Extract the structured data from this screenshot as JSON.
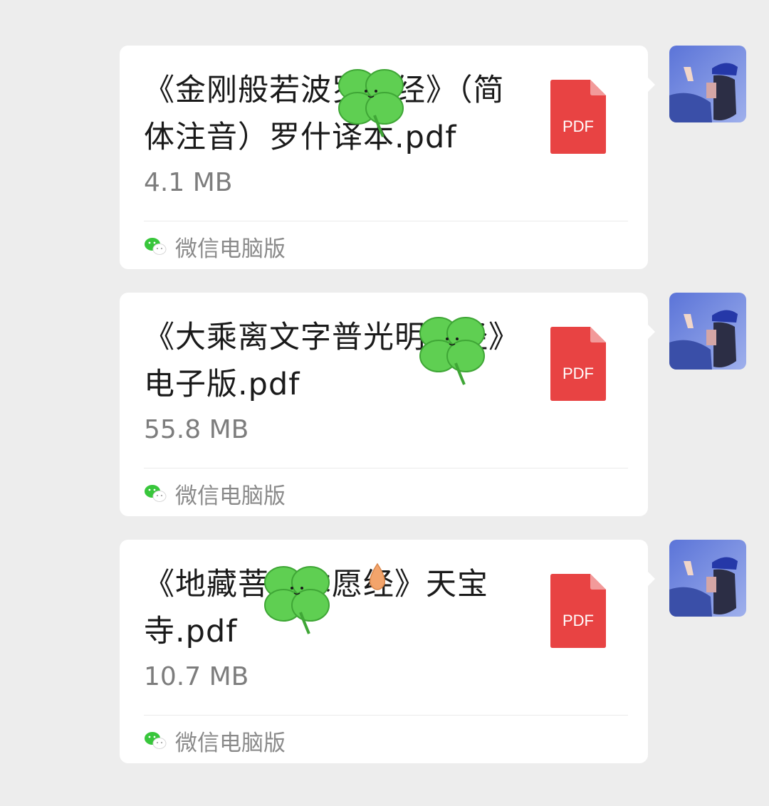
{
  "messages": [
    {
      "file_name": "《金刚般若波罗蜜经》（简体注音）罗什译本.pdf",
      "file_size": "4.1 MB",
      "file_type_badge": "PDF",
      "source_label": "微信电脑版"
    },
    {
      "file_name": "《大乘离文字普光明藏经》电子版.pdf",
      "file_size": "55.8 MB",
      "file_type_badge": "PDF",
      "source_label": "微信电脑版"
    },
    {
      "file_name": "《地藏菩萨本愿经》天宝寺.pdf",
      "file_size": "10.7 MB",
      "file_type_badge": "PDF",
      "source_label": "微信电脑版"
    }
  ],
  "colors": {
    "background": "#ededed",
    "bubble": "#ffffff",
    "pdf_red": "#e84343",
    "wechat_green": "#38c63b",
    "clover_green": "#5fcf52"
  },
  "icons": {
    "file": "pdf-file-icon",
    "source": "wechat-icon",
    "overlay": "four-leaf-clover-sticker"
  }
}
